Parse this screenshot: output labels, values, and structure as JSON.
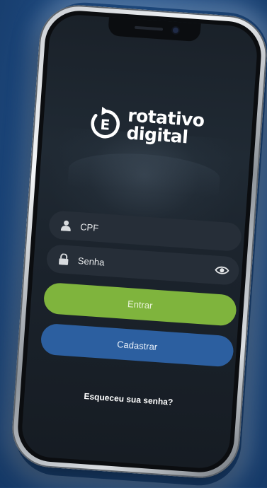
{
  "app": {
    "logo_line1": "rotativo",
    "logo_line2": "digital",
    "logo_mark_letter": "E"
  },
  "form": {
    "cpf_placeholder": "CPF",
    "senha_placeholder": "Senha",
    "cpf_icon": "user-icon",
    "senha_icon": "lock-icon",
    "toggle_icon": "eye-icon"
  },
  "buttons": {
    "entrar_label": "Entrar",
    "cadastrar_label": "Cadastrar"
  },
  "links": {
    "forgot_password": "Esqueceu sua senha?"
  },
  "colors": {
    "background": "#1e4b82",
    "entrar": "#7fb43d",
    "cadastrar": "#2c5fa0",
    "field": "#262e38"
  }
}
